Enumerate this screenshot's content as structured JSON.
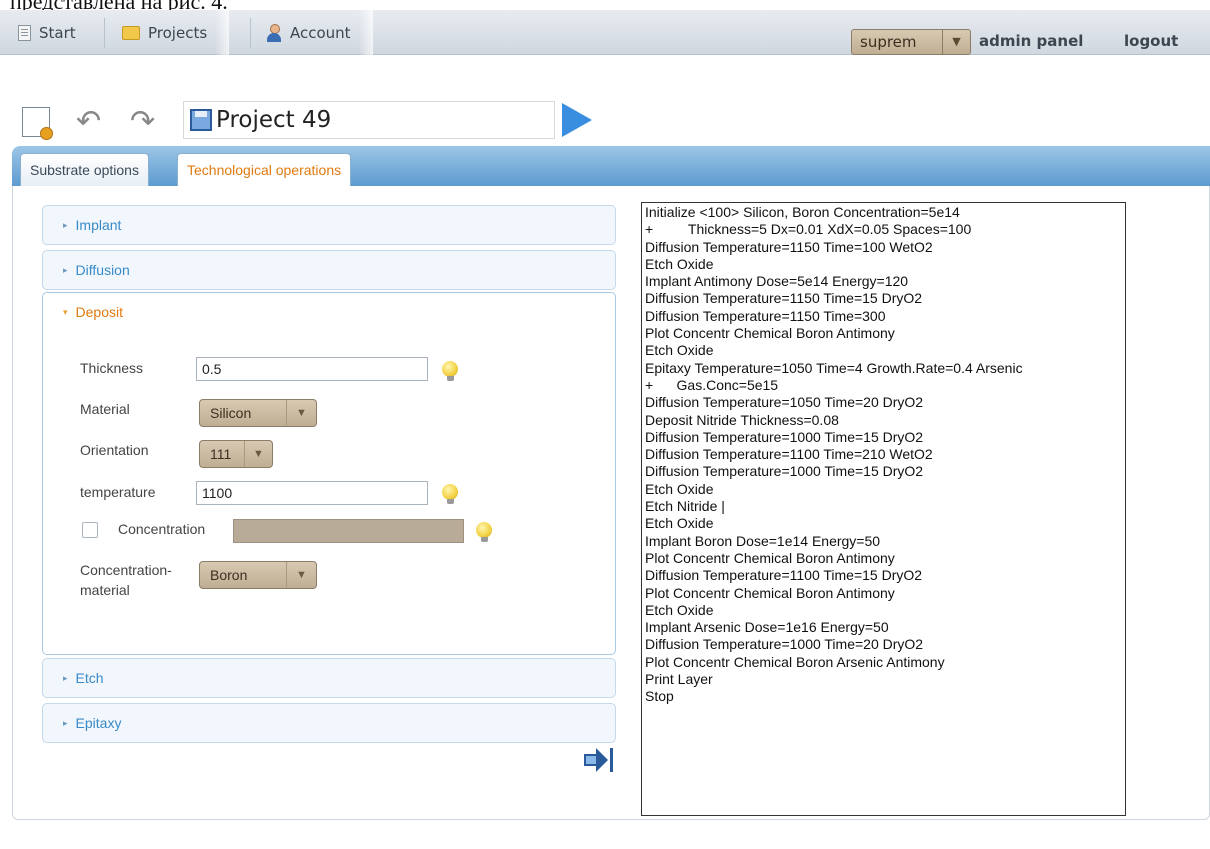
{
  "caption": "представлена на рис. 4.",
  "menubar": {
    "start": "Start",
    "projects": "Projects",
    "account": "Account",
    "user": "suprem",
    "user_arrow": "▼",
    "admin": "admin panel",
    "logout": "logout"
  },
  "toolbar": {
    "undo": "↶",
    "redo": "↷",
    "project_name": "Project 49"
  },
  "tabs": {
    "substrate": "Substrate options",
    "technological": "Technological operations"
  },
  "accordion": {
    "implant": "Implant",
    "diffusion": "Diffusion",
    "deposit": "Deposit",
    "etch": "Etch",
    "epitaxy": "Epitaxy",
    "closed_marker": "▸",
    "open_marker": "▾"
  },
  "deposit_form": {
    "thickness_label": "Thickness",
    "thickness_value": "0.5",
    "material_label": "Material",
    "material_value": "Silicon",
    "orientation_label": "Orientation",
    "orientation_value": "111",
    "temperature_label": "temperature",
    "temperature_value": "1100",
    "concentration_label": "Concentration",
    "concentration_checked": false,
    "conc_material_label_1": "Concentration-",
    "conc_material_label_2": "material",
    "conc_material_value": "Boron",
    "dd_arrow": "▼"
  },
  "script": [
    "Initialize <100> Silicon, Boron Concentration=5e14",
    "+         Thickness=5 Dx=0.01 XdX=0.05 Spaces=100",
    "Diffusion Temperature=1150 Time=100 WetO2",
    "Etch Oxide",
    "Implant Antimony Dose=5e14 Energy=120",
    "Diffusion Temperature=1150 Time=15 DryO2",
    "Diffusion Temperature=1150 Time=300",
    "Plot Concentr Chemical Boron Antimony",
    "Etch Oxide",
    "Epitaxy Temperature=1050 Time=4 Growth.Rate=0.4 Arsenic",
    "+      Gas.Conc=5e15",
    "Diffusion Temperature=1050 Time=20 DryO2",
    "Deposit Nitride Thickness=0.08",
    "Diffusion Temperature=1000 Time=15 DryO2",
    "Diffusion Temperature=1100 Time=210 WetO2",
    "Diffusion Temperature=1000 Time=15 DryO2",
    "Etch Oxide",
    "Etch Nitride |",
    "Etch Oxide",
    "Implant Boron Dose=1e14 Energy=50",
    "Plot Concentr Chemical Boron Antimony",
    "Diffusion Temperature=1100 Time=15 DryO2",
    "Plot Concentr Chemical Boron Antimony",
    "Etch Oxide",
    "Implant Arsenic Dose=1e16 Energy=50",
    "Diffusion Temperature=1000 Time=20 DryO2",
    "Plot Concentr Chemical Boron Arsenic Antimony",
    "Print Layer",
    "Stop"
  ],
  "colors": {
    "accent_orange": "#e07a10",
    "accent_blue": "#3a8ac8",
    "tabbar_blue": "#5d9bd0"
  }
}
